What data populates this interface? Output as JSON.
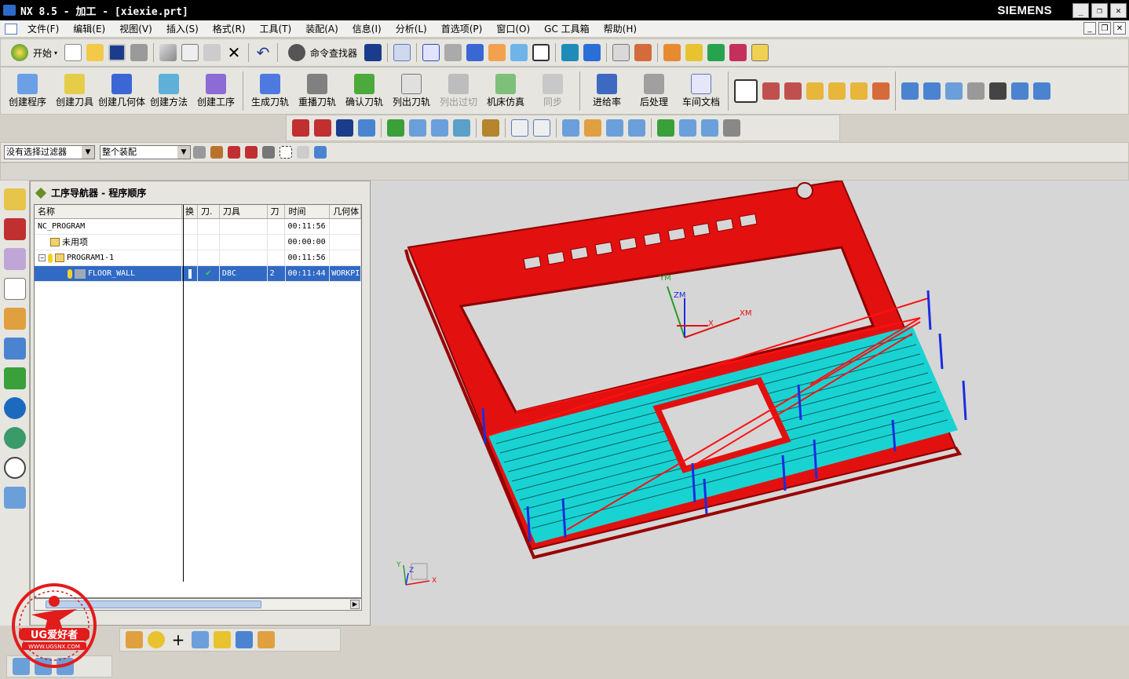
{
  "title": "NX 8.5 - 加工 - [xiexie.prt]",
  "brand": "SIEMENS",
  "menu": [
    "文件(F)",
    "编辑(E)",
    "视图(V)",
    "插入(S)",
    "格式(R)",
    "工具(T)",
    "装配(A)",
    "信息(I)",
    "分析(L)",
    "首选项(P)",
    "窗口(O)",
    "GC 工具箱",
    "帮助(H)"
  ],
  "toolbar": {
    "start_label": "开始",
    "finder_label": "命令查找器"
  },
  "ops_buttons": [
    "创建程序",
    "创建刀具",
    "创建几何体",
    "创建方法",
    "创建工序"
  ],
  "path_buttons": [
    "生成刀轨",
    "重播刀轨",
    "确认刀轨",
    "列出刀轨",
    "列出过切",
    "机床仿真",
    "同步"
  ],
  "post_buttons": [
    "进给率",
    "后处理",
    "车间文档"
  ],
  "filter": {
    "select_filter": "没有选择过滤器",
    "assembly": "整个装配"
  },
  "navigator": {
    "title": "工序导航器 - 程序顺序",
    "columns": [
      "名称",
      "换",
      "刀.",
      "刀具",
      "刀",
      "时间",
      "几何体"
    ],
    "rows": [
      {
        "name": "NC_PROGRAM",
        "tool": "",
        "num": "",
        "time": "00:11:56",
        "geom": ""
      },
      {
        "name": "未用项",
        "tool": "",
        "num": "",
        "time": "00:00:00",
        "geom": ""
      },
      {
        "name": "PROGRAM1-1",
        "tool": "",
        "num": "",
        "time": "00:11:56",
        "geom": ""
      },
      {
        "name": "FLOOR_WALL",
        "tool": "D8C",
        "num": "2",
        "time": "00:11:44",
        "geom": "WORKPI"
      }
    ]
  },
  "axes": {
    "xm": "XM",
    "ym": "YM",
    "zm": "ZM",
    "x": "X",
    "y": "Y",
    "z": "Z"
  },
  "watermark": {
    "brand": "UG爱好者",
    "url": "WWW.UGSNX.COM"
  },
  "colors": {
    "part": "#e31010",
    "toolpath": "#19d3d3",
    "selection": "#316ac5",
    "titlebar": "#000000"
  }
}
